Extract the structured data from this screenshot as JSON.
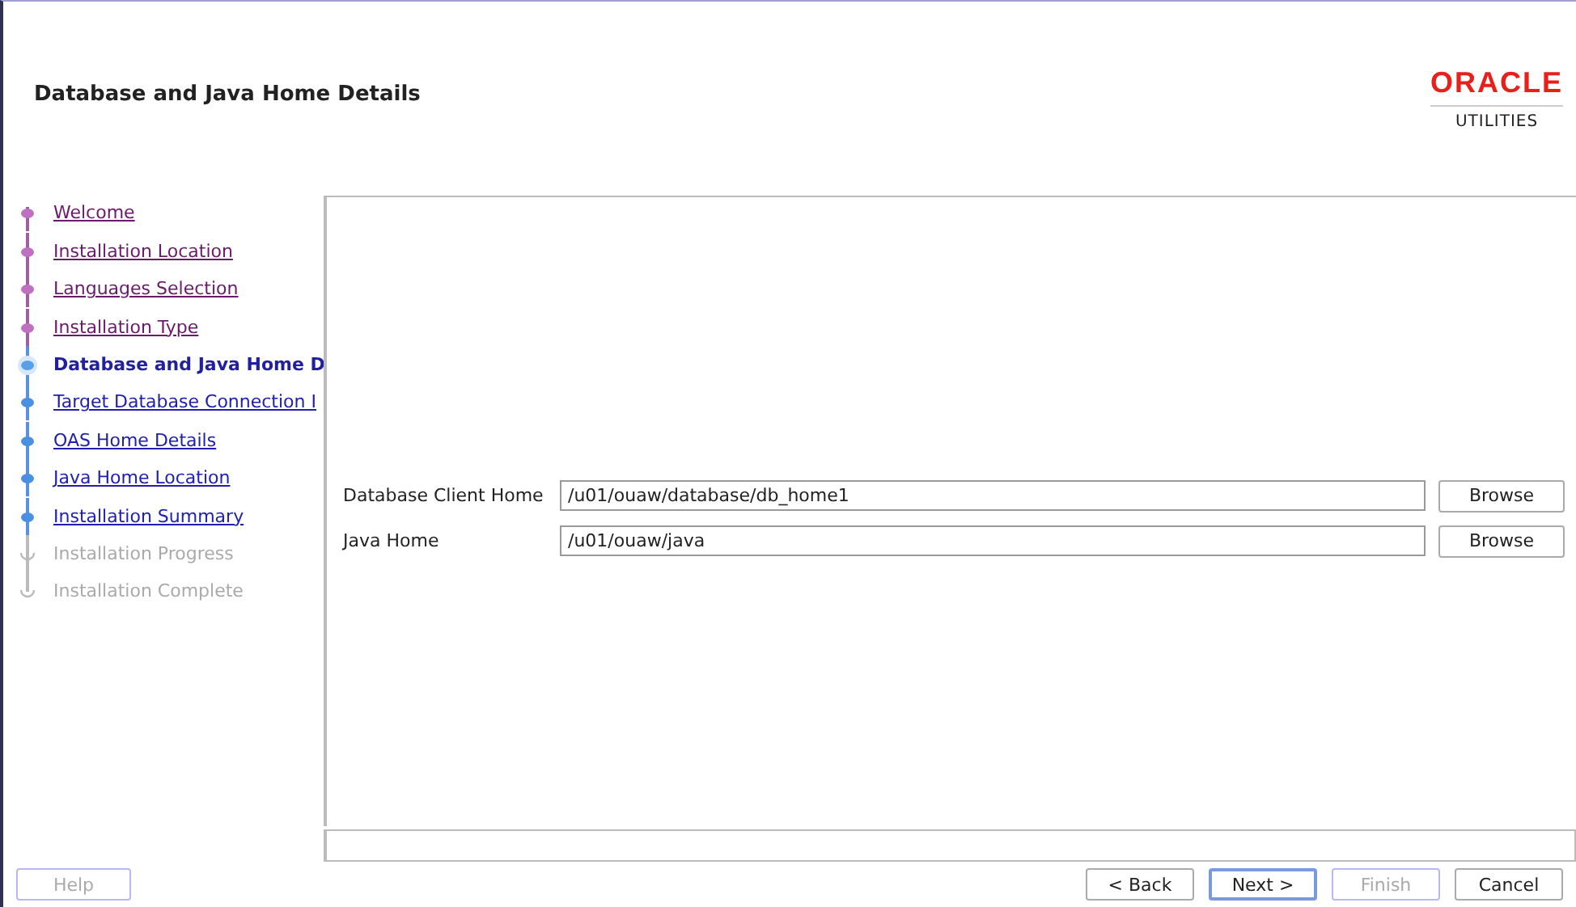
{
  "header": {
    "title": "Database and Java Home Details",
    "logo": {
      "brand": "ORACLE",
      "product": "UTILITIES"
    }
  },
  "steps": [
    {
      "label": "Welcome",
      "visited": true,
      "selected": false,
      "disabled": false
    },
    {
      "label": "Installation Location",
      "visited": true,
      "selected": false,
      "disabled": false
    },
    {
      "label": "Languages Selection",
      "visited": true,
      "selected": false,
      "disabled": false
    },
    {
      "label": "Installation Type",
      "visited": true,
      "selected": false,
      "disabled": false
    },
    {
      "label": "Database and Java Home D",
      "visited": false,
      "selected": true,
      "disabled": false
    },
    {
      "label": "Target Database Connection I",
      "visited": false,
      "selected": false,
      "disabled": false
    },
    {
      "label": "OAS Home Details",
      "visited": false,
      "selected": false,
      "disabled": false
    },
    {
      "label": "Java Home Location",
      "visited": false,
      "selected": false,
      "disabled": false
    },
    {
      "label": "Installation Summary",
      "visited": false,
      "selected": false,
      "disabled": false
    },
    {
      "label": "Installation Progress",
      "visited": false,
      "selected": false,
      "disabled": true
    },
    {
      "label": "Installation Complete",
      "visited": false,
      "selected": false,
      "disabled": true
    }
  ],
  "fields": [
    {
      "label": "Database Client Home",
      "value": "/u01/ouaw/database/db_home1",
      "button": "Browse"
    },
    {
      "label": "Java Home",
      "value": "/u01/ouaw/java",
      "button": "Browse"
    }
  ],
  "help_button": {
    "label": "Help",
    "disabled": true
  },
  "nav_buttons": [
    {
      "label": "< Back",
      "disabled": false,
      "focused": false
    },
    {
      "label": "Next >",
      "disabled": false,
      "focused": true
    },
    {
      "label": "Finish",
      "disabled": true,
      "focused": false
    },
    {
      "label": "Cancel",
      "disabled": false,
      "focused": false
    }
  ]
}
